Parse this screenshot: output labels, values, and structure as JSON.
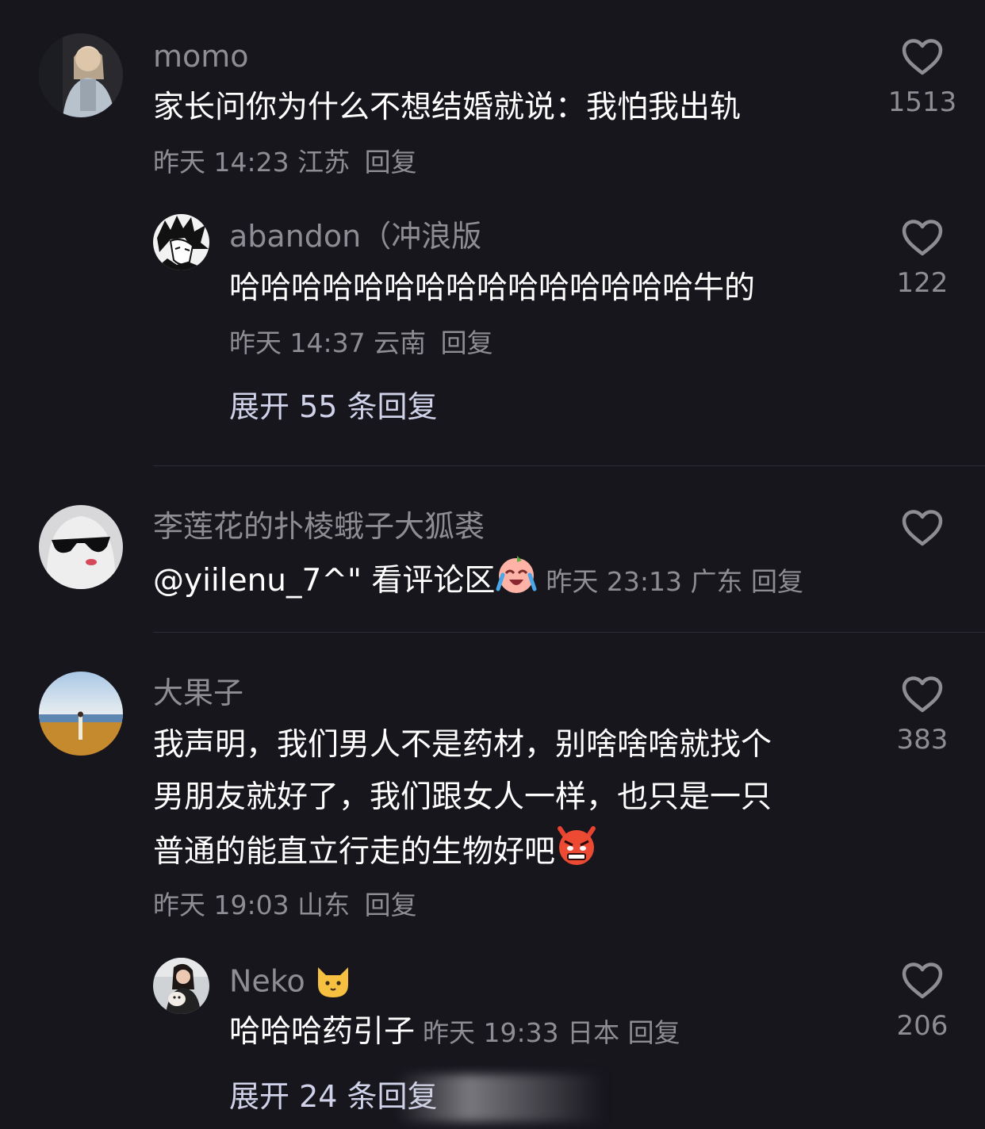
{
  "comments": [
    {
      "username": "momo",
      "text": "家长问你为什么不想结婚就说：我怕我出轨",
      "time": "昨天 14:23",
      "location": "江苏",
      "reply_label": "回复",
      "likes": "1513",
      "avatar_icon": "girl-photo-avatar",
      "replies": [
        {
          "username": "abandon（冲浪版",
          "text": "哈哈哈哈哈哈哈哈哈哈哈哈哈哈哈牛的",
          "time": "昨天 14:37",
          "location": "云南",
          "reply_label": "回复",
          "likes": "122",
          "avatar_icon": "manga-boy-avatar"
        }
      ],
      "expand_label": "展开 55 条回复"
    },
    {
      "username": "李莲花的扑棱蛾子大狐裘",
      "text": "@yiilenu_7^\" 看评论区",
      "emoji": "crying-laughing-emoji",
      "time": "昨天 23:13",
      "location": "广东",
      "reply_label": "回复",
      "likes": "",
      "avatar_icon": "ghost-sunglasses-avatar"
    },
    {
      "username": "大果子",
      "text_lines": [
        "我声明，我们男人不是药材，别啥啥啥就找个",
        "男朋友就好了，我们跟女人一样，也只是一只",
        "普通的能直立行走的生物好吧"
      ],
      "emoji": "angry-devil-emoji",
      "time": "昨天 19:03",
      "location": "山东",
      "reply_label": "回复",
      "likes": "383",
      "avatar_icon": "beach-sunset-avatar",
      "replies": [
        {
          "username": "Neko",
          "username_emoji": "cat-face-emoji",
          "text": "哈哈哈药引子",
          "time": "昨天 19:33",
          "location": "日本",
          "reply_label": "回复",
          "likes": "206",
          "avatar_icon": "girl-with-dog-avatar"
        }
      ],
      "expand_label": "展开 24 条回复"
    }
  ],
  "colors": {
    "background": "#17161d",
    "secondary_text": "#8e8d93",
    "expand_text": "#cfd2e8",
    "divider": "#2c2b33"
  }
}
